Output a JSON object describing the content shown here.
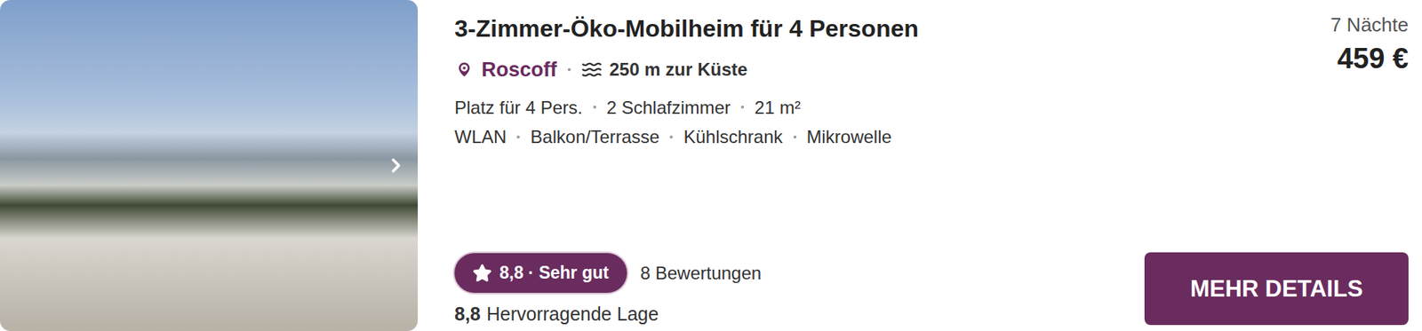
{
  "listing": {
    "title": "3-Zimmer-Öko-Mobilheim für 4 Personen",
    "location": "Roscoff",
    "distance": "250 m zur Küste",
    "details": [
      "Platz für 4 Pers.",
      "2 Schlafzimmer",
      "21 m²"
    ],
    "amenities": [
      "WLAN",
      "Balkon/Terrasse",
      "Kühlschrank",
      "Mikrowelle"
    ],
    "nights": "7 Nächte",
    "price": "459 €",
    "rating": {
      "badge": "8,8 · Sehr gut",
      "reviews": "8 Bewertungen",
      "sub_score": "8,8",
      "sub_label": "Hervorragende Lage"
    },
    "button": "MEHR DETAILS"
  }
}
